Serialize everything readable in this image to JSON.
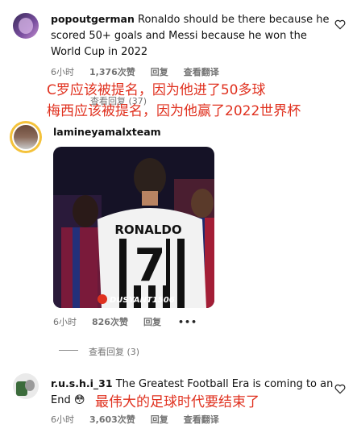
{
  "comments": [
    {
      "username": "popoutgerman",
      "text_line1": "Ronaldo should be there because he",
      "text_line2": "scored 50+ goals and Messi because he won the",
      "text_line3": "World Cup in 2022",
      "time": "6小时",
      "likes": "1,376次赞",
      "reply": "回复",
      "translate": "查看翻译",
      "view_replies": "查看回复 (37)",
      "annotation_line1": "C罗应该被提名，因为他进了50多球",
      "annotation_line2": "梅西应该被提名，因为他赢了2022世界杯"
    },
    {
      "username": "lamineyamalxteam",
      "image_jersey_name": "RONALDO",
      "image_jersey_number": "7",
      "image_watermark": "DUSYANT1506",
      "time": "6小时",
      "likes": "826次赞",
      "reply": "回复",
      "more": "•••",
      "view_replies": "查看回复 (3)"
    },
    {
      "username": "r.u.s.h.i_31",
      "text_line1": "The Greatest Football Era is coming to an",
      "text_line2": "End",
      "emoji": "😳",
      "annotation": "最伟大的足球时代要结束了",
      "time": "6小时",
      "likes": "3,603次赞",
      "reply": "回复",
      "translate": "查看翻译"
    }
  ],
  "colors": {
    "annotation_red": "#e0311f",
    "meta_gray": "#737373"
  },
  "icons": [
    "heart-icon",
    "more-options-icon",
    "flushed-face-emoji"
  ]
}
